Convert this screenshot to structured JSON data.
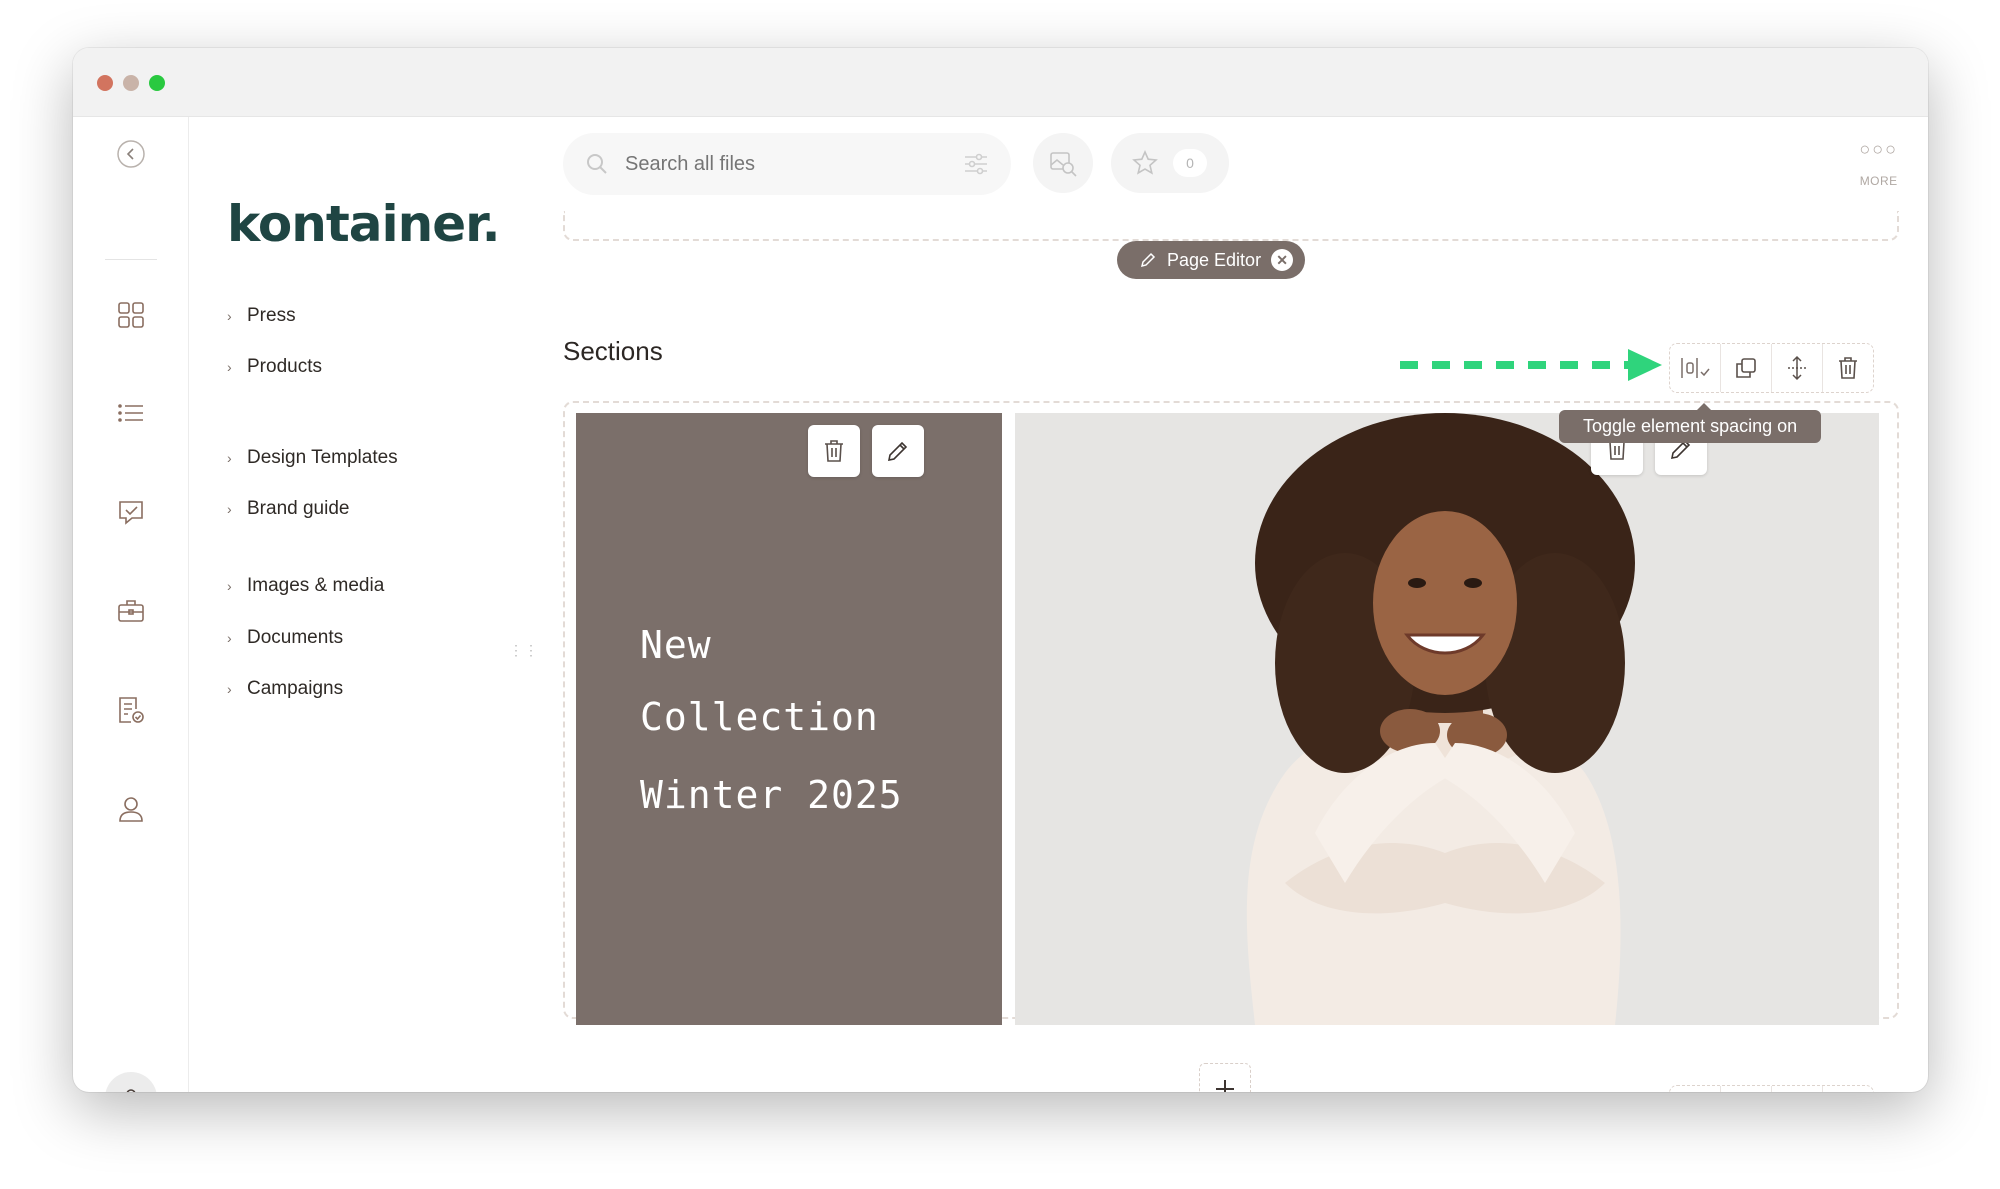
{
  "window": {
    "traffic_lights": [
      "#d2745f",
      "#c9b3a8",
      "#29c940"
    ]
  },
  "rail": {
    "icons": [
      "back-arrow-icon",
      "dashboard-grid-icon",
      "list-icon",
      "message-check-icon",
      "briefcase-icon",
      "document-check-icon",
      "user-icon"
    ]
  },
  "brand": {
    "logo_text": "kontainer.",
    "logo_color": "#1f4543"
  },
  "nav": {
    "items": [
      {
        "label": "Press"
      },
      {
        "label": "Products"
      },
      {
        "label": "Design Templates"
      },
      {
        "label": "Brand guide"
      },
      {
        "label": "Images & media"
      },
      {
        "label": "Documents"
      },
      {
        "label": "Campaigns"
      }
    ]
  },
  "header": {
    "search_placeholder": "Search all files",
    "favorites_count": "0",
    "more_label": "MORE"
  },
  "editor": {
    "badge_label": "Page Editor",
    "sections_title": "Sections",
    "tooltip": "Toggle element spacing on",
    "accent_arrow_color": "#2fd47c",
    "panel_color": "#7b6f6a"
  },
  "hero": {
    "headline": [
      "New",
      "Collection",
      "Winter 2025"
    ]
  }
}
